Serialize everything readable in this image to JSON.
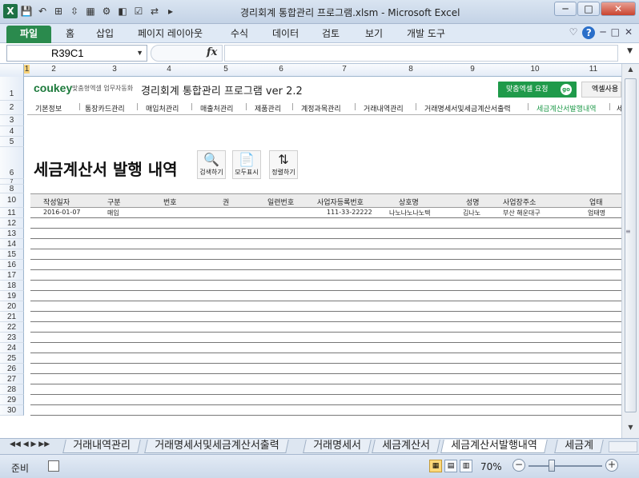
{
  "window": {
    "title": "경리회계 통합관리 프로그램.xlsm  -  Microsoft Excel",
    "minimize": "─",
    "maximize": "□",
    "close": "✕"
  },
  "quick_access": [
    "X",
    "💾",
    "↶",
    "⊞",
    "⇳",
    "▦",
    "⚙",
    "◧",
    "☑",
    "⇄",
    "▸"
  ],
  "ribbon": {
    "file": "파일",
    "tabs": [
      "홈",
      "삽입",
      "페이지 레이아웃",
      "수식",
      "데이터",
      "검토",
      "보기",
      "개발 도구"
    ],
    "right_icons": [
      "♡",
      "?",
      "─",
      "□",
      "✕"
    ]
  },
  "formula_bar": {
    "name_box": "R39C1",
    "fx": "fx",
    "value": ""
  },
  "columns": [
    "1",
    "2",
    "3",
    "4",
    "5",
    "6",
    "7",
    "8",
    "9",
    "10",
    "11"
  ],
  "rows": [
    "1",
    "2",
    "3",
    "4",
    "5",
    "6",
    "7",
    "8",
    "10",
    "11",
    "12",
    "13",
    "14",
    "15",
    "16",
    "17",
    "18",
    "19",
    "20",
    "21",
    "22",
    "23",
    "24",
    "25",
    "26",
    "27",
    "28",
    "29",
    "30"
  ],
  "header": {
    "logo": "coukey",
    "logo_sub": "맞춤형엑셀 업무자동화",
    "program_title": "경리회계 통합관리 프로그램 ver 2.2",
    "green_button": "맞춤엑셀 요청",
    "green_button_go": "go",
    "gray_button": "엑셀사용"
  },
  "nav": [
    "기본정보",
    "통장카드관리",
    "매입처관리",
    "매출처관리",
    "제품관리",
    "계정과목관리",
    "거래내역관리",
    "거래명세서및세금계산서출력",
    "세금계산서발행내역",
    "세"
  ],
  "nav_active": "세금계산서발행내역",
  "page_title": "세금계산서 발행 내역",
  "tools": [
    {
      "icon": "🔍",
      "label": "검색하기"
    },
    {
      "icon": "📄",
      "label": "모두표시"
    },
    {
      "icon": "⇅",
      "label": "정렬하기"
    }
  ],
  "table": {
    "headers": [
      "작성일자",
      "구분",
      "번호",
      "권",
      "일련번호",
      "사업자등록번호",
      "상호명",
      "성명",
      "사업장주소",
      "업태"
    ],
    "rows": [
      [
        "2016-01-07",
        "매입",
        "",
        "",
        "",
        "111-33-22222",
        "나노나노나노텍",
        "김나노",
        "부산 해운대구",
        "업태명"
      ]
    ]
  },
  "sheet_tabs": [
    "거래내역관리",
    "거래명세서및세금계산서출력",
    "거래명세서",
    "세금계산서",
    "세금계산서발행내역",
    "세금계"
  ],
  "sheet_tab_active": "세금계산서발행내역",
  "status": {
    "ready": "준비",
    "zoom": "70%"
  }
}
